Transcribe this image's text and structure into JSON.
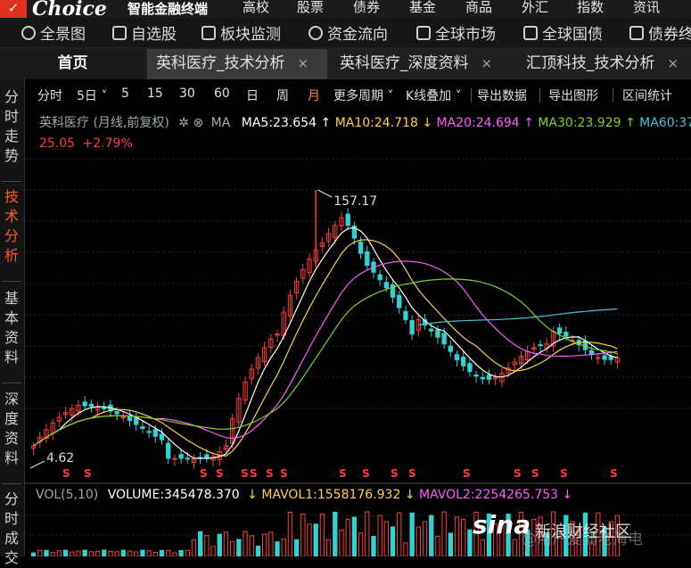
{
  "menubar": {
    "logo": "Choice",
    "logo_sub": "智能金融终端",
    "items": [
      "高校",
      "股票",
      "债券",
      "基金",
      "商品",
      "外汇",
      "指数",
      "资讯"
    ]
  },
  "toolbar": {
    "items": [
      {
        "label": "全景图",
        "icon": "globe-icon"
      },
      {
        "label": "自选股",
        "icon": "document-icon"
      },
      {
        "label": "板块监测",
        "icon": "monitor-icon"
      },
      {
        "label": "资金流向",
        "icon": "yen-icon"
      },
      {
        "label": "全球市场",
        "icon": "bar-chart-icon"
      },
      {
        "label": "全球国债",
        "icon": "clipboard-icon"
      },
      {
        "label": "债券终",
        "icon": "screen-icon"
      }
    ]
  },
  "tabs": {
    "home": "首页",
    "items": [
      {
        "label": "英科医疗_技术分析",
        "active": true
      },
      {
        "label": "英科医疗_深度资料",
        "active": false
      },
      {
        "label": "汇顶科技_技术分析",
        "active": false
      }
    ],
    "close_symbol": "×"
  },
  "sidebar": {
    "items": [
      {
        "label": "分时走势",
        "active": false
      },
      {
        "label": "技术分析",
        "active": true
      },
      {
        "label": "基本资料",
        "active": false
      },
      {
        "label": "深度资料",
        "active": false
      },
      {
        "label": "分时成交",
        "active": false
      }
    ]
  },
  "periodbar": {
    "items": [
      {
        "label": "分时",
        "active": false
      },
      {
        "label": "5日",
        "active": false,
        "dropdown": true
      },
      {
        "label": "5",
        "active": false
      },
      {
        "label": "15",
        "active": false
      },
      {
        "label": "30",
        "active": false
      },
      {
        "label": "60",
        "active": false
      },
      {
        "label": "日",
        "active": false
      },
      {
        "label": "周",
        "active": false
      },
      {
        "label": "月",
        "active": true
      },
      {
        "label": "更多周期",
        "active": false,
        "dropdown": true
      },
      {
        "label": "K线叠加",
        "active": false,
        "dropdown": true
      },
      {
        "label": "导出数据",
        "active": false
      },
      {
        "label": "导出图形",
        "active": false
      },
      {
        "label": "区间统计",
        "active": false
      }
    ]
  },
  "chart_info": {
    "name": "英科医疗 (月线,前复权)",
    "ma_label": "MA",
    "ma5": "MA5:23.654",
    "ma10": "MA10:24.718",
    "ma20": "MA20:24.694",
    "ma30": "MA30:23.929",
    "ma60": "MA60:37",
    "price": "25.05",
    "change": "+2.79%",
    "high_label": "157.17",
    "low_label": "4.62",
    "colors": {
      "up": "#ff3b3b",
      "down": "#2ed3d3",
      "ma5": "#ffffff",
      "ma10": "#ffd23f",
      "ma20": "#ff5aff",
      "ma30": "#7ed321",
      "ma60": "#44c4d0"
    }
  },
  "volume_info": {
    "label": "VOL(5,10)",
    "volume": "VOLUME:345478.370",
    "mavol1": "MAVOL1:1558176.932",
    "mavol2": "MAVOL2:2254265.753",
    "colors": {
      "mavol1": "#ffd23f",
      "mavol2": "#ff5aff"
    }
  },
  "watermark": {
    "brand": "sina",
    "text": "新浪财经社区",
    "sub": "@用户爱浦老海电"
  },
  "chart_data": {
    "type": "candlestick",
    "title": "英科医疗 (月线,前复权)",
    "price_high": 157.17,
    "price_low": 4.62,
    "last_price": 25.05,
    "change_pct": 2.79,
    "moving_averages": {
      "MA5": 23.654,
      "MA10": 24.718,
      "MA20": 24.694,
      "MA30": 23.929
    },
    "volume": 345478.37,
    "mavol1": 1558176.932,
    "mavol2": 2254265.753
  }
}
